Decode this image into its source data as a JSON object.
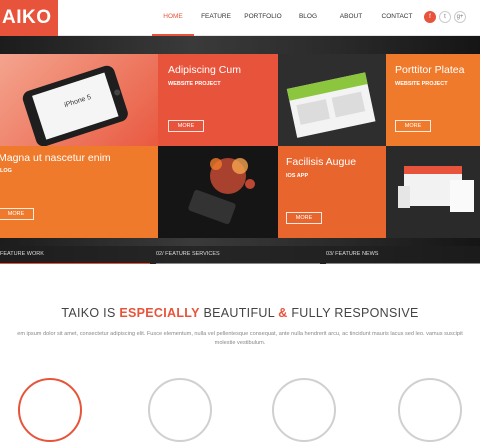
{
  "header": {
    "logo": "AIKO",
    "nav": [
      "HOME",
      "FEATURE",
      "PORTFOLIO",
      "BLOG",
      "ABOUT",
      "CONTACT"
    ],
    "active_index": 0,
    "social": [
      {
        "icon": "facebook-icon",
        "glyph": "f"
      },
      {
        "icon": "twitter-icon",
        "glyph": "t"
      },
      {
        "icon": "google-plus-icon",
        "glyph": "g+"
      }
    ]
  },
  "hero": {
    "tiles": [
      {
        "title": "Adipiscing Cum",
        "subtitle": "WEBSITE PROJECT",
        "button": "MORE"
      },
      {
        "title": "Porttitor Platea",
        "subtitle": "WEBSITE PROJECT",
        "button": "MORE"
      },
      {
        "title": "Magna ut nascetur enim",
        "subtitle": "LOG",
        "button": "MORE"
      },
      {
        "title": "Facilisis Augue",
        "subtitle": "IOS APP",
        "button": "MORE"
      }
    ],
    "phone_label": "iPhone 5",
    "bar": [
      {
        "label": "FEATURE WORK"
      },
      {
        "label": "02/ FEATURE SERVICES"
      },
      {
        "label": "03/ FEATURE NEWS"
      }
    ]
  },
  "section": {
    "headline_parts": [
      "TAIKO IS ",
      "ESPECIALLY",
      " BEAUTIFUL ",
      "&",
      " FULLY RESPONSIVE"
    ],
    "intro_line1": "em ipsum dolor sit amet, consectetur adipiscing elit. Fusce elementum, nulla vel pellentesque consequat, ante nulla hendrerit arcu, ac tincidunt mauris lacus sed leo. vamus suscipit",
    "intro_line2": "molestie vestibulum."
  },
  "colors": {
    "accent": "#e8543b",
    "orange": "#f07a2b",
    "dark": "#2b2b2b"
  }
}
